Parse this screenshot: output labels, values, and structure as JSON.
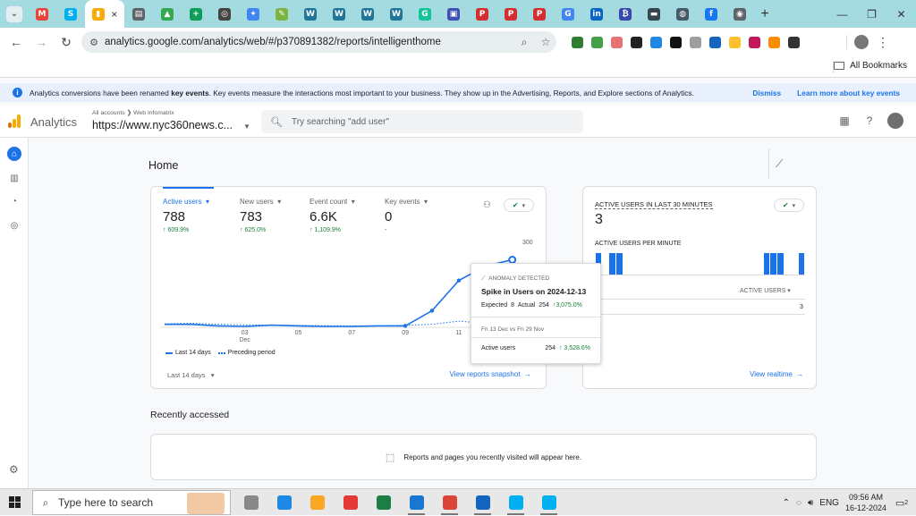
{
  "browser": {
    "tabs": [
      {
        "icon": "gmail-icon",
        "color": "#ea4335",
        "glyph": "M"
      },
      {
        "icon": "skype-icon",
        "color": "#00aff0",
        "glyph": "S"
      },
      {
        "icon": "analytics-icon",
        "color": "#f9ab00",
        "glyph": "×"
      },
      {
        "icon": "print-icon",
        "color": "#5f6368",
        "glyph": "▤"
      },
      {
        "icon": "drive-icon",
        "color": "#34a853",
        "glyph": "▲"
      },
      {
        "icon": "sheets-icon",
        "color": "#0f9d58",
        "glyph": "+"
      },
      {
        "icon": "chatgpt-icon",
        "color": "#444444",
        "glyph": "◎"
      },
      {
        "icon": "gemini-icon",
        "color": "#4285f4",
        "glyph": "✦"
      },
      {
        "icon": "pen-icon",
        "color": "#7cb342",
        "glyph": "✎"
      },
      {
        "icon": "wordpress-icon",
        "color": "#21759b",
        "glyph": "W"
      },
      {
        "icon": "wordpress-icon",
        "color": "#21759b",
        "glyph": "W"
      },
      {
        "icon": "wordpress-icon",
        "color": "#21759b",
        "glyph": "W"
      },
      {
        "icon": "wordpress-icon",
        "color": "#21759b",
        "glyph": "W"
      },
      {
        "icon": "grammarly-icon",
        "color": "#15c39a",
        "glyph": "G"
      },
      {
        "icon": "user-icon",
        "color": "#3f51b5",
        "glyph": "▣"
      },
      {
        "icon": "pdf-icon",
        "color": "#d32f2f",
        "glyph": "P"
      },
      {
        "icon": "pdf-icon",
        "color": "#d32f2f",
        "glyph": "P"
      },
      {
        "icon": "pdf-icon",
        "color": "#d32f2f",
        "glyph": "P"
      },
      {
        "icon": "google-icon",
        "color": "#4285f4",
        "glyph": "G"
      },
      {
        "icon": "linkedin-icon",
        "color": "#0a66c2",
        "glyph": "in"
      },
      {
        "icon": "bitcoin-icon",
        "color": "#3949ab",
        "glyph": "₿"
      },
      {
        "icon": "media-icon",
        "color": "#37474f",
        "glyph": "▬"
      },
      {
        "icon": "globe-icon",
        "color": "#455a64",
        "glyph": "◍"
      },
      {
        "icon": "facebook-icon",
        "color": "#1877f2",
        "glyph": "f"
      },
      {
        "icon": "chrome-icon",
        "color": "#5f6368",
        "glyph": "◉"
      }
    ],
    "active_close": "×",
    "newtab": "+",
    "url": "analytics.google.com/analytics/web/#/p370891382/reports/intelligenthome",
    "extensions": [
      "#2e7d32",
      "#43a047",
      "#e57373",
      "#212121",
      "#1e88e5",
      "#111111",
      "#9e9e9e",
      "#1565c0",
      "#fbc02d",
      "#c2185b",
      "#fb8c00",
      "#333333"
    ],
    "all_bookmarks": "All Bookmarks"
  },
  "banner": {
    "text_before": "Analytics conversions have been renamed ",
    "text_bold": "key events",
    "text_after": ". Key events measure the interactions most important to your business. They show up in the Advertising, Reports, and Explore sections of Analytics.",
    "dismiss": "Dismiss",
    "learn_more": "Learn more about key events"
  },
  "header": {
    "product": "Analytics",
    "breadcrumb": "All accounts ❯ Web Infomatrix",
    "property": "https://www.nyc360news.c...",
    "search_placeholder": "Try searching \"add user\""
  },
  "home": {
    "title": "Home",
    "metrics": [
      {
        "label": "Active users",
        "value": "788",
        "change": "↑ 609.9%"
      },
      {
        "label": "New users",
        "value": "783",
        "change": "↑ 625.0%"
      },
      {
        "label": "Event count",
        "value": "6.6K",
        "change": "↑ 1,109.9%"
      },
      {
        "label": "Key events",
        "value": "0",
        "change": "-"
      }
    ],
    "y_max_label": "300",
    "x_ticks": [
      "03\nDec",
      "05",
      "07",
      "09",
      "11",
      "13"
    ],
    "legend_current": "Last 14 days",
    "legend_previous": "Preceding period",
    "range": "Last 14 days",
    "snapshot_link": "View reports snapshot"
  },
  "chart_data": {
    "type": "line",
    "x": [
      "2024-11-30",
      "2024-12-01",
      "2024-12-02",
      "2024-12-03",
      "2024-12-04",
      "2024-12-05",
      "2024-12-06",
      "2024-12-07",
      "2024-12-08",
      "2024-12-09",
      "2024-12-10",
      "2024-12-11",
      "2024-12-12",
      "2024-12-13",
      "2024-12-14"
    ],
    "series": [
      {
        "name": "Last 14 days",
        "values": [
          8,
          8,
          2,
          0,
          5,
          2,
          0,
          0,
          2,
          2,
          60,
          175,
          230,
          254,
          0
        ]
      },
      {
        "name": "Preceding period",
        "values": [
          10,
          12,
          8,
          6,
          5,
          4,
          3,
          2,
          3,
          4,
          8,
          20,
          12,
          8,
          6
        ]
      }
    ],
    "ylim": [
      0,
      300
    ],
    "highlight_index": 13
  },
  "tooltip": {
    "anomaly": "ANOMALY DETECTED",
    "title": "Spike in Users on 2024-12-13",
    "expected_label": "Expected",
    "expected": "8",
    "actual_label": "Actual",
    "actual": "254",
    "actual_change": "↑3,075.0%",
    "compare": "Fri 13 Dec vs Fri 29 Nov",
    "metric": "Active users",
    "metric_value": "254",
    "metric_change": "↑ 3,528.6%"
  },
  "realtime": {
    "title": "ACTIVE USERS IN LAST 30 MINUTES",
    "value": "3",
    "per_minute": "ACTIVE USERS PER MINUTE",
    "column": "ACTIVE USERS",
    "row_value": "3",
    "link": "View realtime",
    "bars": [
      1,
      0,
      1,
      1,
      0,
      0,
      0,
      0,
      0,
      0,
      0,
      0,
      0,
      0,
      0,
      0,
      0,
      0,
      0,
      0,
      0,
      0,
      0,
      0,
      1,
      1,
      1,
      0,
      0,
      1
    ]
  },
  "recent": {
    "title": "Recently accessed",
    "empty": "Reports and pages you recently visited will appear here."
  },
  "taskbar": {
    "search_placeholder": "Type here to search",
    "lang": "ENG",
    "time": "09:56 AM",
    "date": "16-12-2024",
    "notifications": "2",
    "apps": [
      "#888888",
      "#1e88e5",
      "#f9a825",
      "#e53935",
      "#1b7e45",
      "#1976d2",
      "#db4437",
      "#1565c0",
      "#00aff0",
      "#00aff0"
    ]
  }
}
